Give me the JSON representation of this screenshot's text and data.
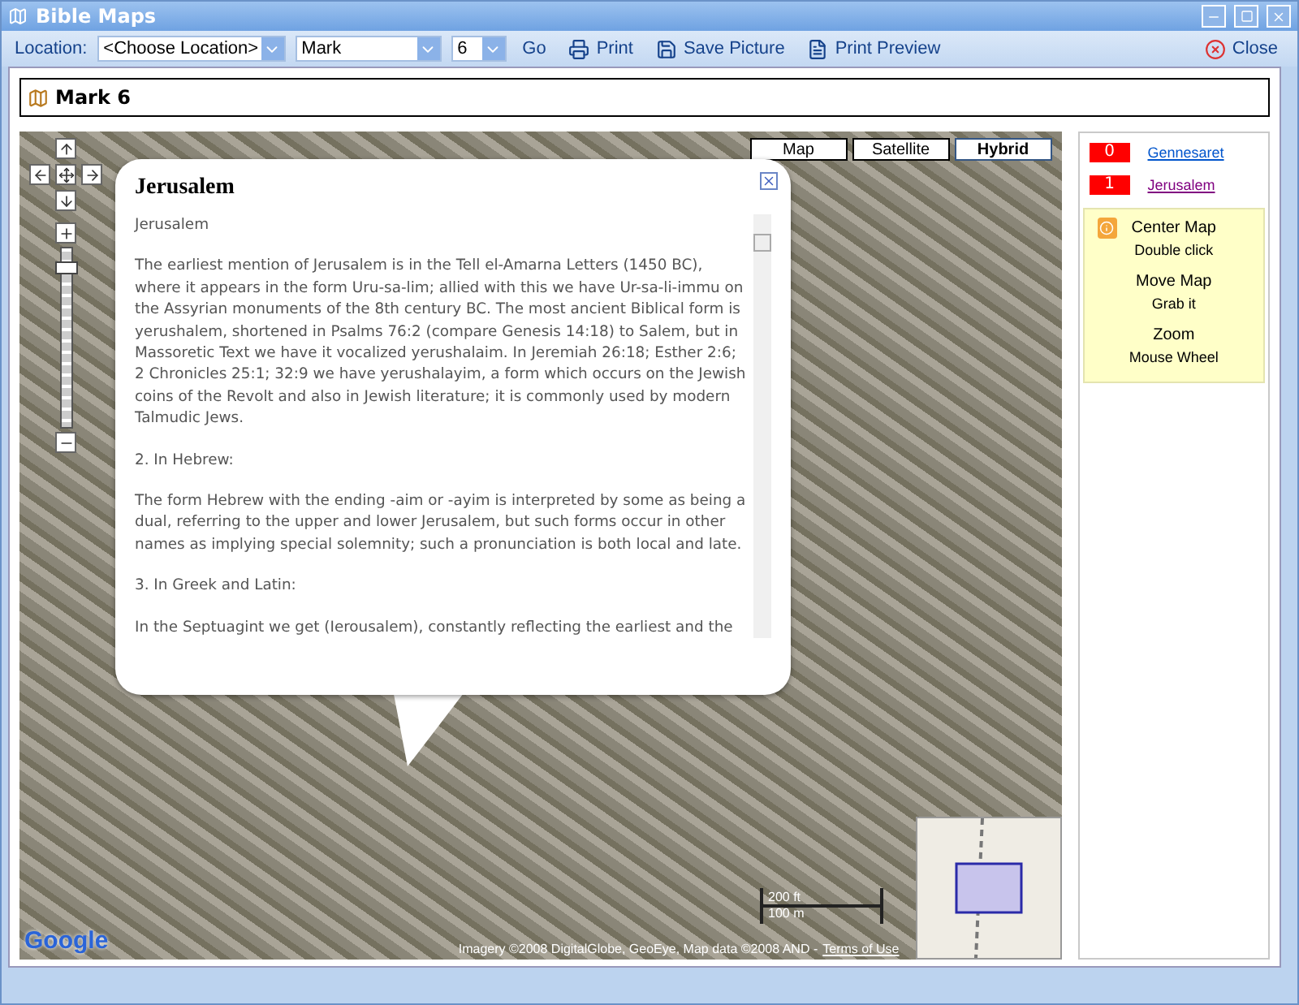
{
  "window": {
    "title": "Bible Maps"
  },
  "toolbar": {
    "location_label": "Location:",
    "location": "<Choose Location>",
    "book": "Mark",
    "chapter": "6",
    "go": "Go",
    "print": "Print",
    "save": "Save Picture",
    "preview": "Print Preview",
    "close": "Close"
  },
  "header": {
    "title": "Mark 6"
  },
  "map": {
    "types": [
      {
        "label": "Map",
        "selected": false
      },
      {
        "label": "Satellite",
        "selected": false
      },
      {
        "label": "Hybrid",
        "selected": true
      }
    ],
    "zoom": {
      "level": 0.92
    },
    "popup": {
      "title": "Jerusalem",
      "paragraphs": [
        "Jerusalem",
        "The earliest mention of Jerusalem is in the Tell el-Amarna Letters (1450 BC), where it appears in the form Uru-sa-lim; allied with this we have Ur-sa-li-immu on the Assyrian monuments of the 8th century BC. The most ancient Biblical form is yerushalem, shortened in Psalms 76:2 (compare Genesis 14:18) to Salem, but in Massoretic Text we have it vocalized yerushalaim. In Jeremiah 26:18; Esther 2:6; 2 Chronicles 25:1; 32:9 we have yerushalayim, a form which occurs on the Jewish coins of the Revolt and also in Jewish literature; it is commonly used by modern Talmudic Jews.",
        "2. In Hebrew:",
        "The form Hebrew with the ending -aim or -ayim is interpreted by some as being a dual, referring to the upper and lower Jerusalem, but such forms occur in other names as implying special solemnity; such a pronunciation is both local and late.",
        "3. In Greek and Latin:",
        "In the Septuagint we get (Ierousalem), constantly reflecting the earliest and the"
      ]
    },
    "logo": "Google",
    "scale": [
      "200 ft",
      "100 m"
    ],
    "copyright": "Imagery ©2008 DigitalGlobe, GeoEye, Map data ©2008 AND -",
    "terms": "Terms of Use"
  },
  "places": [
    {
      "number": "0",
      "name": "Gennesaret",
      "visited": false
    },
    {
      "number": "1",
      "name": "Jerusalem",
      "visited": true
    }
  ],
  "help": [
    {
      "title": "Center Map",
      "text": "Double click"
    },
    {
      "title": "Move Map",
      "text": "Grab it"
    },
    {
      "title": "Zoom",
      "text": "Mouse Wheel"
    }
  ]
}
